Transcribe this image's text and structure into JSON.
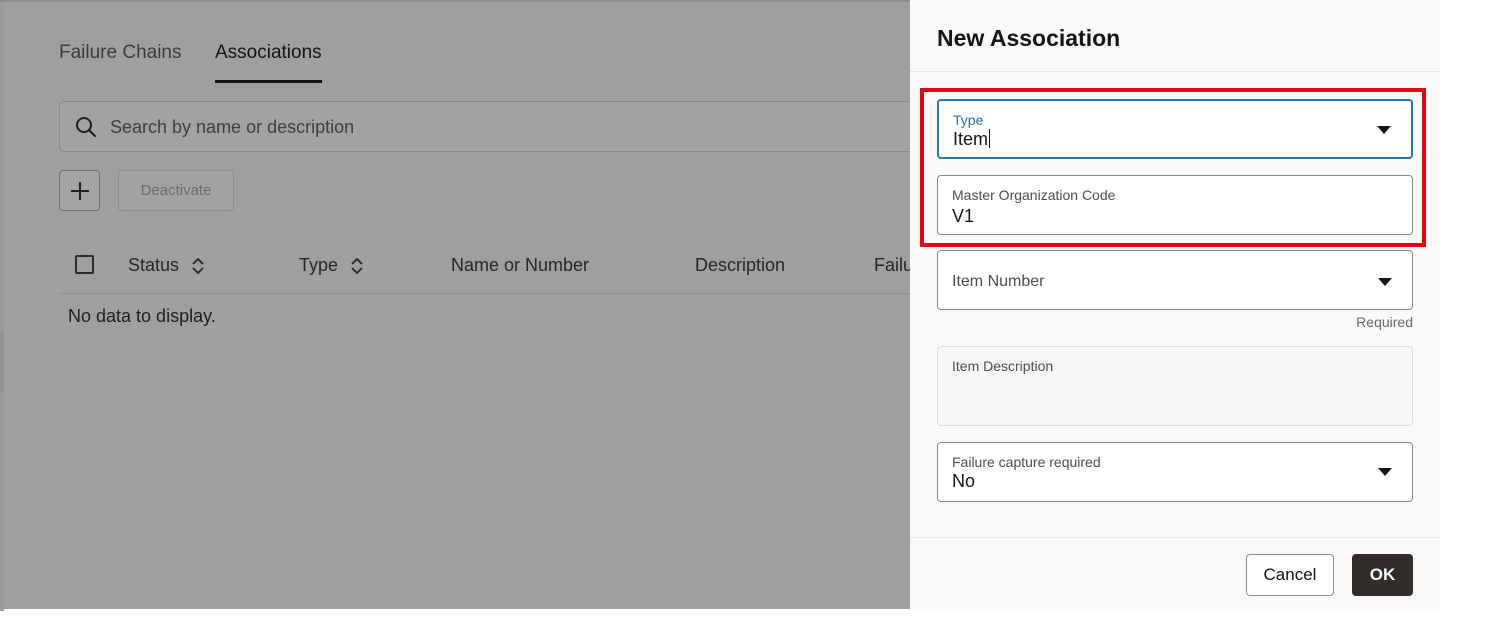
{
  "tabs": [
    {
      "label": "Failure Chains",
      "active": false
    },
    {
      "label": "Associations",
      "active": true
    }
  ],
  "search": {
    "placeholder": "Search by name or description"
  },
  "toolbar": {
    "add_icon": "plus-icon",
    "deactivate_label": "Deactivate"
  },
  "table": {
    "columns": [
      {
        "label": "Status",
        "sortable": true
      },
      {
        "label": "Type",
        "sortable": true
      },
      {
        "label": "Name or Number",
        "sortable": false
      },
      {
        "label": "Description",
        "sortable": false
      },
      {
        "label": "Failu",
        "sortable": false
      }
    ],
    "empty_message": "No data to display."
  },
  "drawer": {
    "title": "New Association",
    "fields": {
      "type": {
        "label": "Type",
        "value": "Item"
      },
      "master_org": {
        "label": "Master Organization Code",
        "value": "V1"
      },
      "item_number": {
        "label": "Item Number",
        "value": "",
        "helper": "Required"
      },
      "item_description": {
        "label": "Item Description",
        "value": ""
      },
      "failure_capture": {
        "label": "Failure capture required",
        "value": "No"
      }
    },
    "cancel_label": "Cancel",
    "ok_label": "OK"
  },
  "colors": {
    "overlay": "#a09f9e",
    "focus_accent": "#227e9e",
    "primary_button": "#312d2a",
    "highlight_box": "#e30613"
  }
}
